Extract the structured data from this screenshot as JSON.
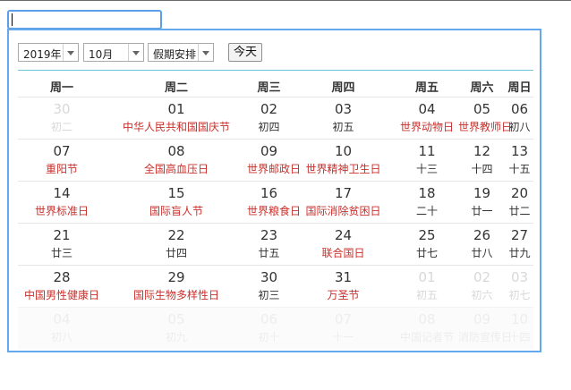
{
  "input": {
    "value": ""
  },
  "toolbar": {
    "year": "2019年",
    "month": "10月",
    "holiday": "假期安排",
    "today": "今天"
  },
  "weekdays": [
    "周一",
    "周二",
    "周三",
    "周四",
    "周五",
    "周六",
    "周日"
  ],
  "weeks": [
    [
      {
        "d": "30",
        "l": "初二",
        "o": true
      },
      {
        "d": "01",
        "l": "中华人民共和国国庆节",
        "h": true
      },
      {
        "d": "02",
        "l": "初四"
      },
      {
        "d": "03",
        "l": "初五"
      },
      {
        "d": "04",
        "l": "世界动物日",
        "h": true
      },
      {
        "d": "05",
        "l": "世界教师日",
        "h": true
      },
      {
        "d": "06",
        "l": "初八"
      }
    ],
    [
      {
        "d": "07",
        "l": "重阳节",
        "h": true
      },
      {
        "d": "08",
        "l": "全国高血压日",
        "h": true
      },
      {
        "d": "09",
        "l": "世界邮政日",
        "h": true
      },
      {
        "d": "10",
        "l": "世界精神卫生日",
        "h": true
      },
      {
        "d": "11",
        "l": "十三"
      },
      {
        "d": "12",
        "l": "十四"
      },
      {
        "d": "13",
        "l": "十五"
      }
    ],
    [
      {
        "d": "14",
        "l": "世界标准日",
        "h": true
      },
      {
        "d": "15",
        "l": "国际盲人节",
        "h": true
      },
      {
        "d": "16",
        "l": "世界粮食日",
        "h": true
      },
      {
        "d": "17",
        "l": "国际消除贫困日",
        "h": true
      },
      {
        "d": "18",
        "l": "二十"
      },
      {
        "d": "19",
        "l": "廿一"
      },
      {
        "d": "20",
        "l": "廿二"
      }
    ],
    [
      {
        "d": "21",
        "l": "廿三"
      },
      {
        "d": "22",
        "l": "廿四"
      },
      {
        "d": "23",
        "l": "廿五"
      },
      {
        "d": "24",
        "l": "联合国日",
        "h": true
      },
      {
        "d": "25",
        "l": "廿七"
      },
      {
        "d": "26",
        "l": "廿八"
      },
      {
        "d": "27",
        "l": "廿九"
      }
    ],
    [
      {
        "d": "28",
        "l": "中国男性健康日",
        "h": true
      },
      {
        "d": "29",
        "l": "国际生物多样性日",
        "h": true
      },
      {
        "d": "30",
        "l": "初三"
      },
      {
        "d": "31",
        "l": "万圣节",
        "h": true
      },
      {
        "d": "01",
        "l": "初五",
        "o": true
      },
      {
        "d": "02",
        "l": "初六",
        "o": true
      },
      {
        "d": "03",
        "l": "初七",
        "o": true
      }
    ],
    [
      {
        "d": "04",
        "l": "初八",
        "o": true
      },
      {
        "d": "05",
        "l": "初九",
        "o": true
      },
      {
        "d": "06",
        "l": "初十",
        "o": true
      },
      {
        "d": "07",
        "l": "十一",
        "o": true
      },
      {
        "d": "08",
        "l": "中国记者节",
        "o": true
      },
      {
        "d": "09",
        "l": "消防宣传日",
        "o": true
      },
      {
        "d": "10",
        "l": "十四",
        "o": true
      }
    ]
  ]
}
